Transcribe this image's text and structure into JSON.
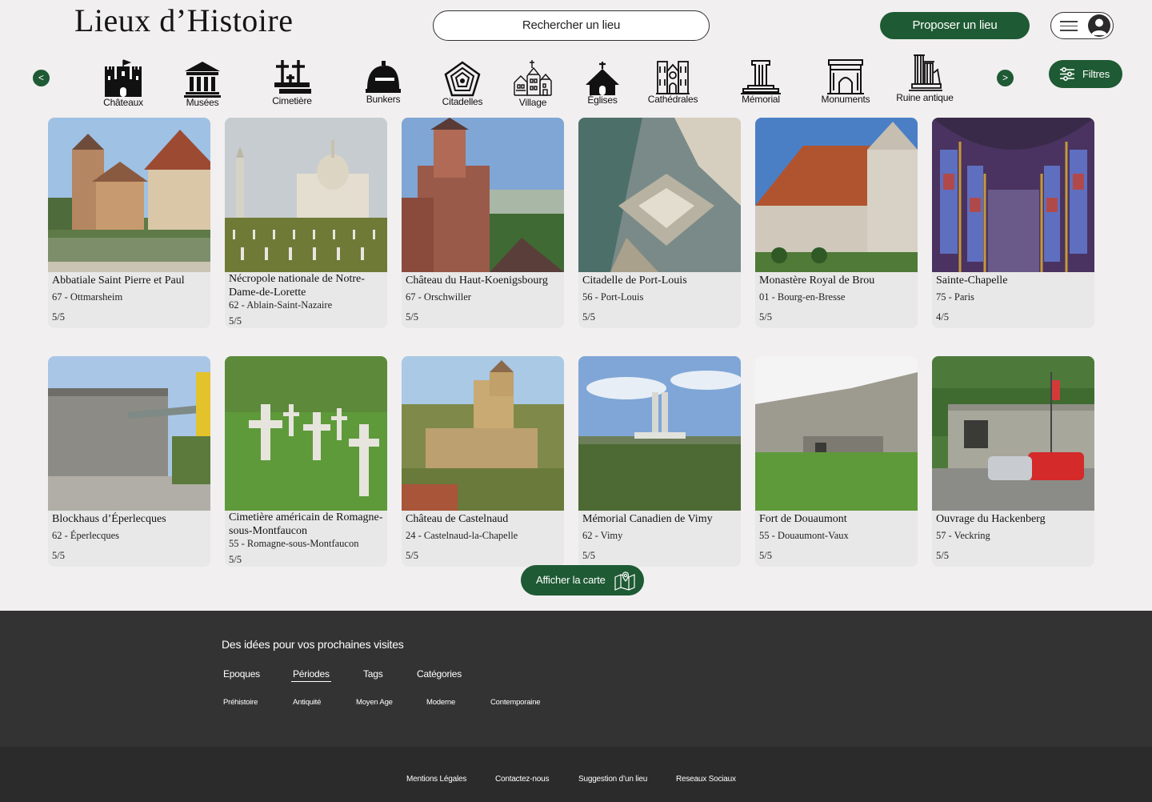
{
  "header": {
    "logo": "Lieux d’Histoire",
    "search_label": "Rechercher un lieu",
    "propose_label": "Proposer un lieu",
    "menu_icon": "hamburger-icon",
    "avatar_icon": "user-icon"
  },
  "categories": {
    "prev_label": "<",
    "next_label": ">",
    "filters_label": "Filtres",
    "items": [
      {
        "label": "Châteaux",
        "icon": "castle-icon"
      },
      {
        "label": "Musées",
        "icon": "museum-icon"
      },
      {
        "label": "Cimetière",
        "icon": "cemetery-icon"
      },
      {
        "label": "Bunkers",
        "icon": "bunker-icon"
      },
      {
        "label": "Citadelles",
        "icon": "citadel-icon"
      },
      {
        "label": "Village",
        "icon": "village-icon"
      },
      {
        "label": "Églises",
        "icon": "church-icon"
      },
      {
        "label": "Cathédrales",
        "icon": "cathedral-icon"
      },
      {
        "label": "Mémorial",
        "icon": "memorial-icon"
      },
      {
        "label": "Monuments",
        "icon": "arch-monument-icon"
      },
      {
        "label": "Ruine antique",
        "icon": "ruin-icon"
      }
    ]
  },
  "places": [
    {
      "title": "Abbatiale Saint Pierre et Paul",
      "location": "67 - Ottmarsheim",
      "rating": "5/5"
    },
    {
      "title": "Nécropole nationale de Notre-Dame-de-Lorette",
      "location": "62 - Ablain-Saint-Nazaire",
      "rating": "5/5"
    },
    {
      "title": "Château du Haut-Koenigsbourg",
      "location": "67 - Orschwiller",
      "rating": "5/5"
    },
    {
      "title": "Citadelle de Port-Louis",
      "location": "56 - Port-Louis",
      "rating": "5/5"
    },
    {
      "title": "Monastère Royal de Brou",
      "location": "01 - Bourg-en-Bresse",
      "rating": "5/5"
    },
    {
      "title": "Sainte-Chapelle",
      "location": "75 - Paris",
      "rating": "4/5"
    },
    {
      "title": "Blockhaus d’Éperlecques",
      "location": "62 - Éperlecques",
      "rating": "5/5"
    },
    {
      "title": "Cimetière américain de Romagne-sous-Montfaucon",
      "location": "55 - Romagne-sous-Montfaucon",
      "rating": "5/5"
    },
    {
      "title": "Château de Castelnaud",
      "location": "24 - Castelnaud-la-Chapelle",
      "rating": "5/5"
    },
    {
      "title": "Mémorial Canadien de Vimy",
      "location": "62 - Vimy",
      "rating": "5/5"
    },
    {
      "title": "Fort de Douaumont",
      "location": "55 -  Douaumont-Vaux",
      "rating": "5/5"
    },
    {
      "title": "Ouvrage du Hackenberg",
      "location": "57 - Veckring",
      "rating": "5/5"
    }
  ],
  "map_button": {
    "label": "Afficher la carte",
    "icon": "map-pin-icon"
  },
  "footer": {
    "heading": "Des idées pour vos prochaines visites",
    "tabs": [
      "Epoques",
      "Périodes",
      "Tags",
      "Catégories"
    ],
    "active_tab": "Périodes",
    "periods": [
      "Préhistoire",
      "Antiquité",
      "Moyen Age",
      "Moderne",
      "Contemporaine"
    ],
    "links": [
      "Mentions Légales",
      "Contactez-nous",
      "Suggestion d’un lieu",
      "Reseaux Sociaux"
    ]
  },
  "colors": {
    "accent": "#1e5a33",
    "background": "#f1eff0",
    "footer": "#343333",
    "footer_bottom": "#2c2b2b",
    "card": "#e9e8e8"
  }
}
